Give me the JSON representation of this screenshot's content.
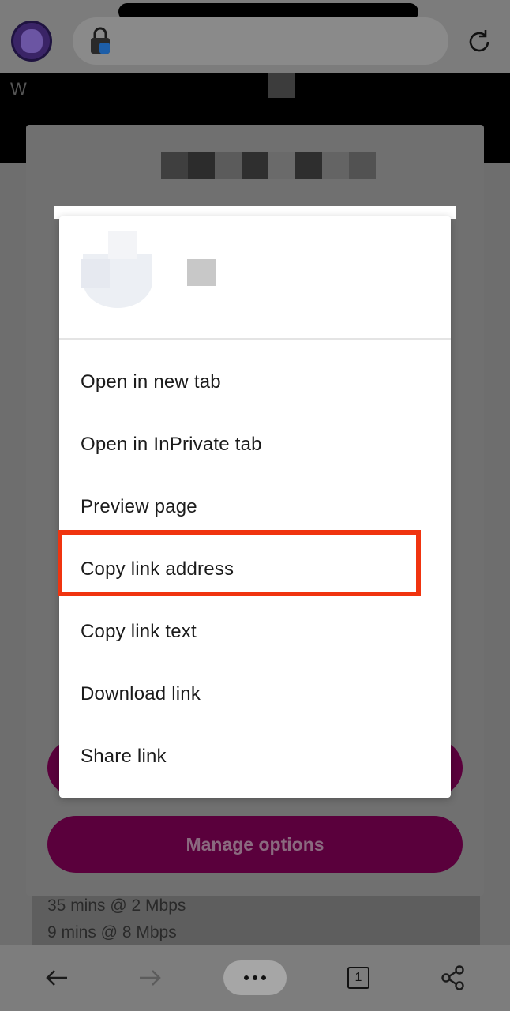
{
  "browser": {
    "avatar_icon": "profile-avatar-icon",
    "lock_icon": "lock-icon",
    "refresh_icon": "refresh-icon"
  },
  "page": {
    "header_initial": "W",
    "manage_button_label": "Manage options",
    "info_lines": [
      "35 mins @ 2 Mbps",
      "9 mins @ 8 Mbps"
    ]
  },
  "context_menu": {
    "items": [
      {
        "label": "Open in new tab"
      },
      {
        "label": "Open in InPrivate tab"
      },
      {
        "label": "Preview page"
      },
      {
        "label": "Copy link address"
      },
      {
        "label": "Copy link text"
      },
      {
        "label": "Download link"
      },
      {
        "label": "Share link"
      }
    ],
    "highlighted_item": "Copy link address",
    "highlight_color": "#f0340f"
  },
  "toolbar": {
    "back_icon": "arrow-left-icon",
    "forward_icon": "arrow-right-icon",
    "more_icon": "more-dots-icon",
    "tab_count": "1",
    "share_icon": "share-icon"
  },
  "colors": {
    "overlay": "#6e6e6e",
    "consent_button": "#5a003c",
    "menu_background": "#ffffff"
  }
}
